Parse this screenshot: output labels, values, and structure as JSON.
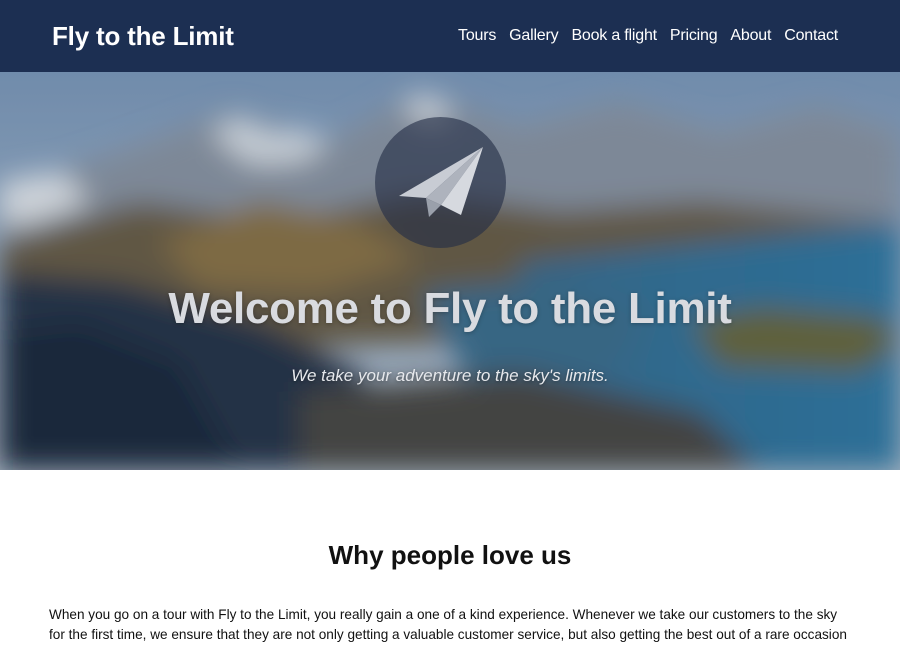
{
  "navbar": {
    "brand": "Fly to the Limit",
    "links": [
      "Tours",
      "Gallery",
      "Book a flight",
      "Pricing",
      "About",
      "Contact"
    ]
  },
  "hero": {
    "logo_icon": "paper-plane-icon",
    "title": "Welcome to Fly to the Limit",
    "subtitle": "We take your adventure to the sky's limits."
  },
  "about": {
    "heading": "Why people love us",
    "body": "When you go on a tour with Fly to the Limit, you really gain a one of a kind experience. Whenever we take our customers to the sky for the first time, we ensure that they are not only getting a valuable customer service, but also getting the best out of a rare occasion"
  },
  "colors": {
    "navbar_bg": "#1c2f52",
    "nav_text": "#ffffff",
    "hero_title": "#d9dbe0",
    "body_text": "#111111"
  }
}
